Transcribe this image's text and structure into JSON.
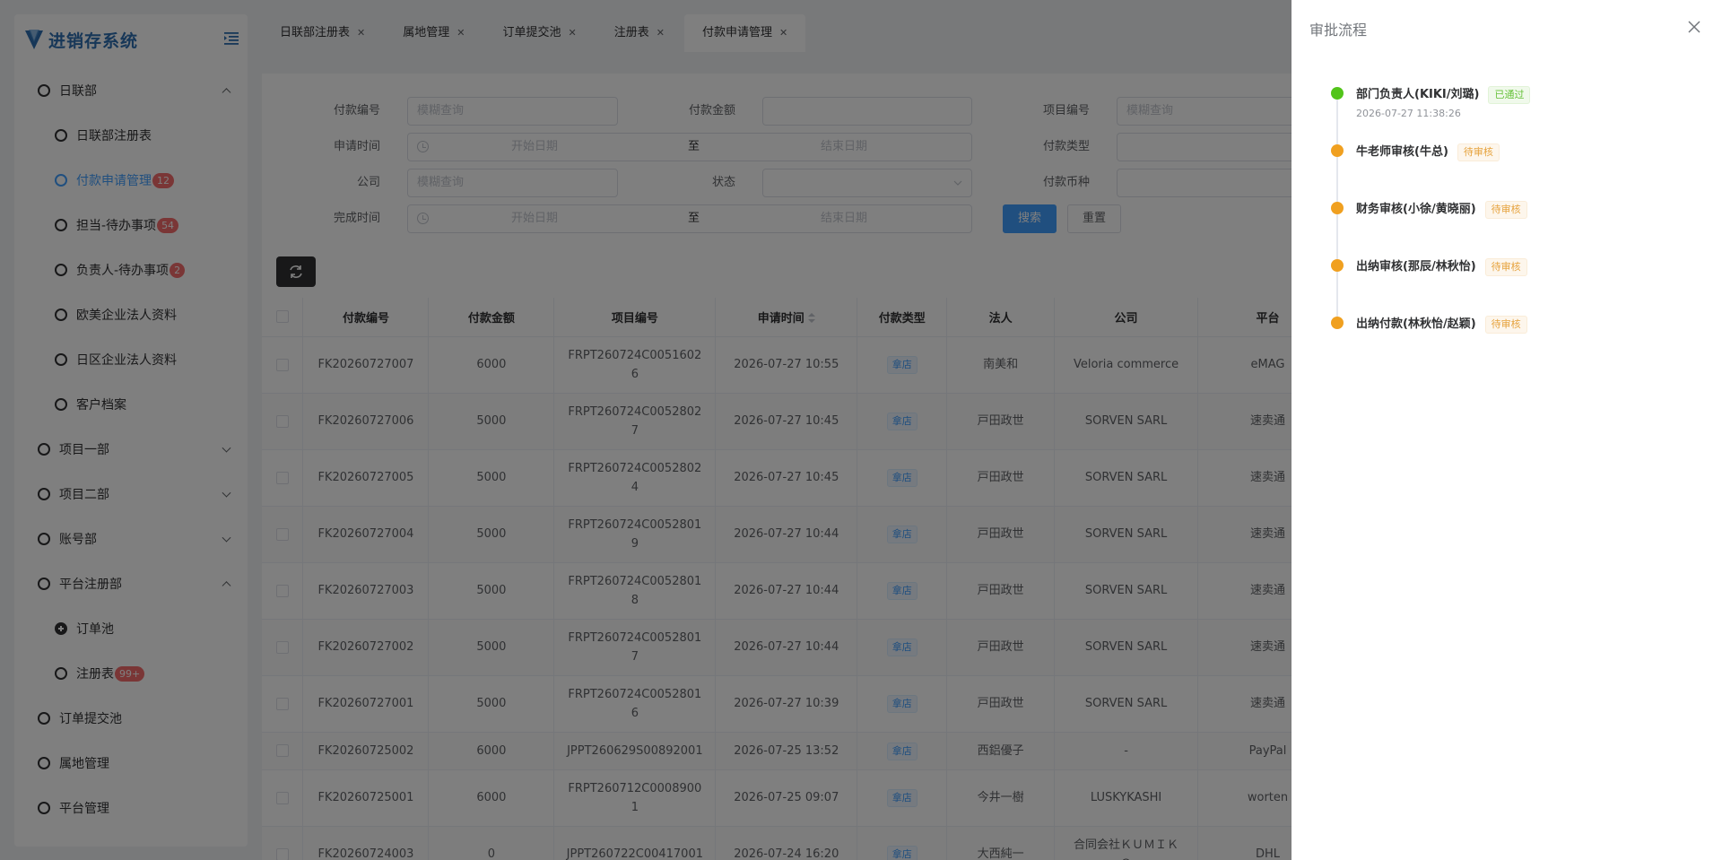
{
  "sidebar": {
    "logo_text": "进销存系统",
    "menu": [
      {
        "label": "日联部",
        "level": 1,
        "arrow": "up"
      },
      {
        "label": "日联部注册表",
        "level": 2
      },
      {
        "label": "付款申请管理",
        "level": 2,
        "badge": "12",
        "active": true
      },
      {
        "label": "担当-待办事项",
        "level": 2,
        "badge": "54"
      },
      {
        "label": "负责人-待办事项",
        "level": 2,
        "badge": "2"
      },
      {
        "label": "欧美企业法人资料",
        "level": 2
      },
      {
        "label": "日区企业法人资料",
        "level": 2
      },
      {
        "label": "客户档案",
        "level": 2
      },
      {
        "label": "项目一部",
        "level": 1,
        "arrow": "down"
      },
      {
        "label": "项目二部",
        "level": 1,
        "arrow": "down"
      },
      {
        "label": "账号部",
        "level": 1,
        "arrow": "down"
      },
      {
        "label": "平台注册部",
        "level": 1,
        "arrow": "up"
      },
      {
        "label": "订单池",
        "level": 2,
        "filled": true
      },
      {
        "label": "注册表",
        "level": 2,
        "badge": "99+"
      },
      {
        "label": "订单提交池",
        "level": 1
      },
      {
        "label": "属地管理",
        "level": 1
      },
      {
        "label": "平台管理",
        "level": 1
      }
    ]
  },
  "tabs": [
    {
      "label": "日联部注册表"
    },
    {
      "label": "属地管理"
    },
    {
      "label": "订单提交池"
    },
    {
      "label": "注册表"
    },
    {
      "label": "付款申请管理",
      "active": true
    }
  ],
  "search_form": {
    "payment_no_label": "付款编号",
    "payment_no_placeholder": "模糊查询",
    "amount_label": "付款金额",
    "project_no_label": "项目编号",
    "project_no_placeholder": "模糊查询",
    "apply_time_label": "申请时间",
    "start_date": "开始日期",
    "range_sep": "至",
    "end_date": "结束日期",
    "payment_type_label": "付款类型",
    "company_label": "公司",
    "company_placeholder": "模糊查询",
    "status_label": "状态",
    "currency_label": "付款币种",
    "complete_time_label": "完成时间",
    "search_button": "搜索",
    "reset_button": "重置"
  },
  "table": {
    "columns": [
      "付款编号",
      "付款金额",
      "项目编号",
      "申请时间",
      "付款类型",
      "法人",
      "公司",
      "平台"
    ],
    "rows": [
      {
        "no": "FK20260727007",
        "amount": "6000",
        "project": "FRPT260724C00516026",
        "project_l1": "FRPT260724C0051602",
        "project_l2": "6",
        "time": "2026-07-27 10:55",
        "type": "拿店",
        "legal": "南美和",
        "company": "Veloria commerce",
        "platform": "eMAG"
      },
      {
        "no": "FK20260727006",
        "amount": "5000",
        "project": "FRPT260724C00528027",
        "project_l1": "FRPT260724C0052802",
        "project_l2": "7",
        "time": "2026-07-27 10:45",
        "type": "拿店",
        "legal": "戸田政世",
        "company": "SORVEN SARL",
        "platform": "速卖通"
      },
      {
        "no": "FK20260727005",
        "amount": "5000",
        "project": "FRPT260724C00528024",
        "project_l1": "FRPT260724C0052802",
        "project_l2": "4",
        "time": "2026-07-27 10:45",
        "type": "拿店",
        "legal": "戸田政世",
        "company": "SORVEN SARL",
        "platform": "速卖通"
      },
      {
        "no": "FK20260727004",
        "amount": "5000",
        "project": "FRPT260724C00528019",
        "project_l1": "FRPT260724C0052801",
        "project_l2": "9",
        "time": "2026-07-27 10:44",
        "type": "拿店",
        "legal": "戸田政世",
        "company": "SORVEN SARL",
        "platform": "速卖通"
      },
      {
        "no": "FK20260727003",
        "amount": "5000",
        "project": "FRPT260724C00528018",
        "project_l1": "FRPT260724C0052801",
        "project_l2": "8",
        "time": "2026-07-27 10:44",
        "type": "拿店",
        "legal": "戸田政世",
        "company": "SORVEN SARL",
        "platform": "速卖通"
      },
      {
        "no": "FK20260727002",
        "amount": "5000",
        "project": "FRPT260724C00528017",
        "project_l1": "FRPT260724C0052801",
        "project_l2": "7",
        "time": "2026-07-27 10:44",
        "type": "拿店",
        "legal": "戸田政世",
        "company": "SORVEN SARL",
        "platform": "速卖通"
      },
      {
        "no": "FK20260727001",
        "amount": "5000",
        "project": "FRPT260724C00528016",
        "project_l1": "FRPT260724C0052801",
        "project_l2": "6",
        "time": "2026-07-27 10:39",
        "type": "拿店",
        "legal": "戸田政世",
        "company": "SORVEN SARL",
        "platform": "速卖通"
      },
      {
        "no": "FK20260725002",
        "amount": "6000",
        "project": "JPPT260629S00892001",
        "project_l1": "JPPT260629S00892001",
        "project_l2": "",
        "time": "2026-07-25 13:52",
        "type": "拿店",
        "legal": "西鋁優子",
        "company": "-",
        "platform": "PayPal"
      },
      {
        "no": "FK20260725001",
        "amount": "6000",
        "project": "FRPT260712C00089001",
        "project_l1": "FRPT260712C0008900",
        "project_l2": "1",
        "time": "2026-07-25 09:07",
        "type": "拿店",
        "legal": "今井一樹",
        "company": "LUSKYKASHI",
        "platform": "worten"
      },
      {
        "no": "FK20260724003",
        "amount": "0",
        "project": "JPPT260722C00417001",
        "project_l1": "JPPT260722C00417001",
        "project_l2": "",
        "time": "2026-07-24 16:20",
        "type": "拿店",
        "legal": "大西純一",
        "company": "合同会社ＫＵＭＩＫＯ",
        "company_l1": "合同会社ＫＵＭＩＫ",
        "company_l2": "Ｏ",
        "platform": "DHL"
      }
    ]
  },
  "drawer": {
    "title": "审批流程",
    "steps": [
      {
        "name": "部门负责人(KIKI/刘璐)",
        "status": "已通过",
        "state": "ok",
        "color": "#52c41a",
        "time": "2026-07-27 11:38:26"
      },
      {
        "name": "牛老师审核(牛总)",
        "status": "待审核",
        "state": "wait",
        "color": "#f0a020",
        "time": ""
      },
      {
        "name": "财务审核(小徐/黄晓丽)",
        "status": "待审核",
        "state": "wait",
        "color": "#f0a020",
        "time": ""
      },
      {
        "name": "出纳审核(那辰/林秋怡)",
        "status": "待审核",
        "state": "wait",
        "color": "#f0a020",
        "time": ""
      },
      {
        "name": "出纳付款(林秋怡/赵颖)",
        "status": "待审核",
        "state": "wait",
        "color": "#f0a020",
        "time": ""
      }
    ]
  }
}
